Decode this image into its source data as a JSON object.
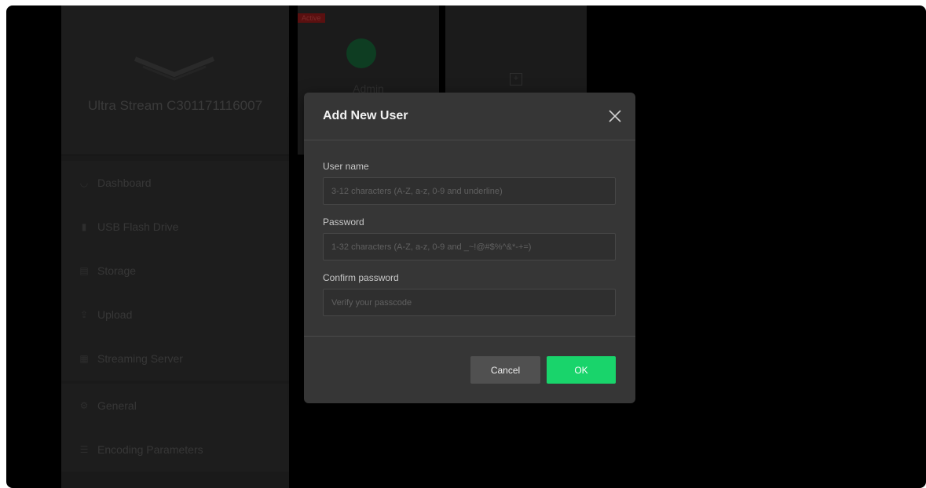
{
  "device": {
    "name": "Ultra Stream C301171116007"
  },
  "sidebar": {
    "items": [
      {
        "label": "Dashboard",
        "icon": "dashboard-icon"
      },
      {
        "label": "USB Flash Drive",
        "icon": "usb-icon"
      },
      {
        "label": "Storage",
        "icon": "storage-icon"
      },
      {
        "label": "Upload",
        "icon": "upload-icon"
      },
      {
        "label": "Streaming Server",
        "icon": "server-icon"
      }
    ],
    "settings_items": [
      {
        "label": "General",
        "icon": "gear-icon"
      },
      {
        "label": "Encoding Parameters",
        "icon": "sliders-icon"
      }
    ]
  },
  "users": {
    "active_badge": "Active",
    "current_user": "Admin"
  },
  "dialog": {
    "title": "Add New User",
    "username": {
      "label": "User name",
      "placeholder": "3-12 characters (A-Z, a-z, 0-9 and underline)",
      "value": ""
    },
    "password": {
      "label": "Password",
      "placeholder": "1-32 characters (A-Z, a-z, 0-9 and _~!@#$%^&*-+=)",
      "value": ""
    },
    "confirm": {
      "label": "Confirm password",
      "placeholder": "Verify your passcode",
      "value": ""
    },
    "cancel_label": "Cancel",
    "ok_label": "OK"
  },
  "colors": {
    "accent": "#19d46b",
    "modal_bg": "#363636",
    "overlay_bg": "#000000",
    "badge_red": "#5a1010"
  }
}
